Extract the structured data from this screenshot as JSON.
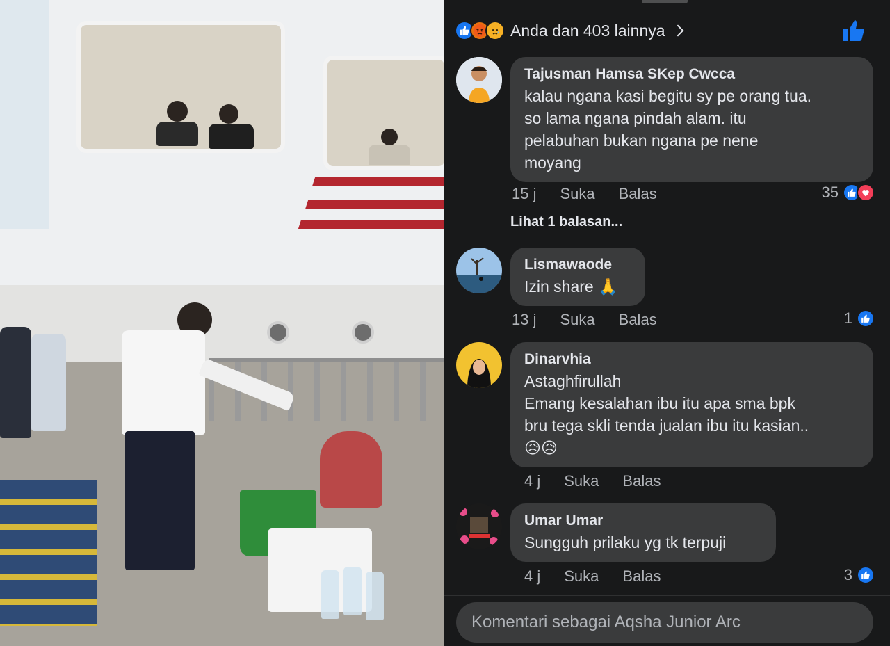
{
  "reactions": {
    "summary": "Anda dan 403 lainnya",
    "icons": [
      "like-icon",
      "angry-icon",
      "sad-icon"
    ]
  },
  "comments": [
    {
      "author": "Tajusman Hamsa SKep Cwcca",
      "text": "kalau ngana kasi begitu sy pe orang tua.\nso lama ngana pindah alam. itu\npelabuhan bukan ngana pe nene\nmoyang",
      "time": "15 j",
      "like_label": "Suka",
      "reply_label": "Balas",
      "reaction_count": "35",
      "reaction_icons": [
        "like-icon",
        "love-icon"
      ],
      "view_replies": "Lihat 1 balasan..."
    },
    {
      "author": "Lismawaode",
      "text": "Izin share 🙏",
      "time": "13 j",
      "like_label": "Suka",
      "reply_label": "Balas",
      "reaction_count": "1",
      "reaction_icons": [
        "like-icon"
      ]
    },
    {
      "author": "Dinarvhia",
      "text": "Astaghfirullah\nEmang kesalahan ibu itu apa sma bpk\nbru tega skli tenda jualan ibu itu kasian..\n😥😥",
      "time": "4 j",
      "like_label": "Suka",
      "reply_label": "Balas"
    },
    {
      "author": "Umar Umar",
      "text": "Sungguh prilaku yg  tk terpuji",
      "time": "4 j",
      "like_label": "Suka",
      "reply_label": "Balas",
      "reaction_count": "3",
      "reaction_icons": [
        "like-icon"
      ]
    }
  ],
  "composer": {
    "placeholder": "Komentari sebagai Aqsha Junior Arc"
  },
  "colors": {
    "background": "#18191a",
    "bubble": "#3a3b3c",
    "text_primary": "#e4e6eb",
    "text_secondary": "#b0b3b8",
    "like_blue": "#1877f2",
    "love_red": "#f33e58"
  }
}
